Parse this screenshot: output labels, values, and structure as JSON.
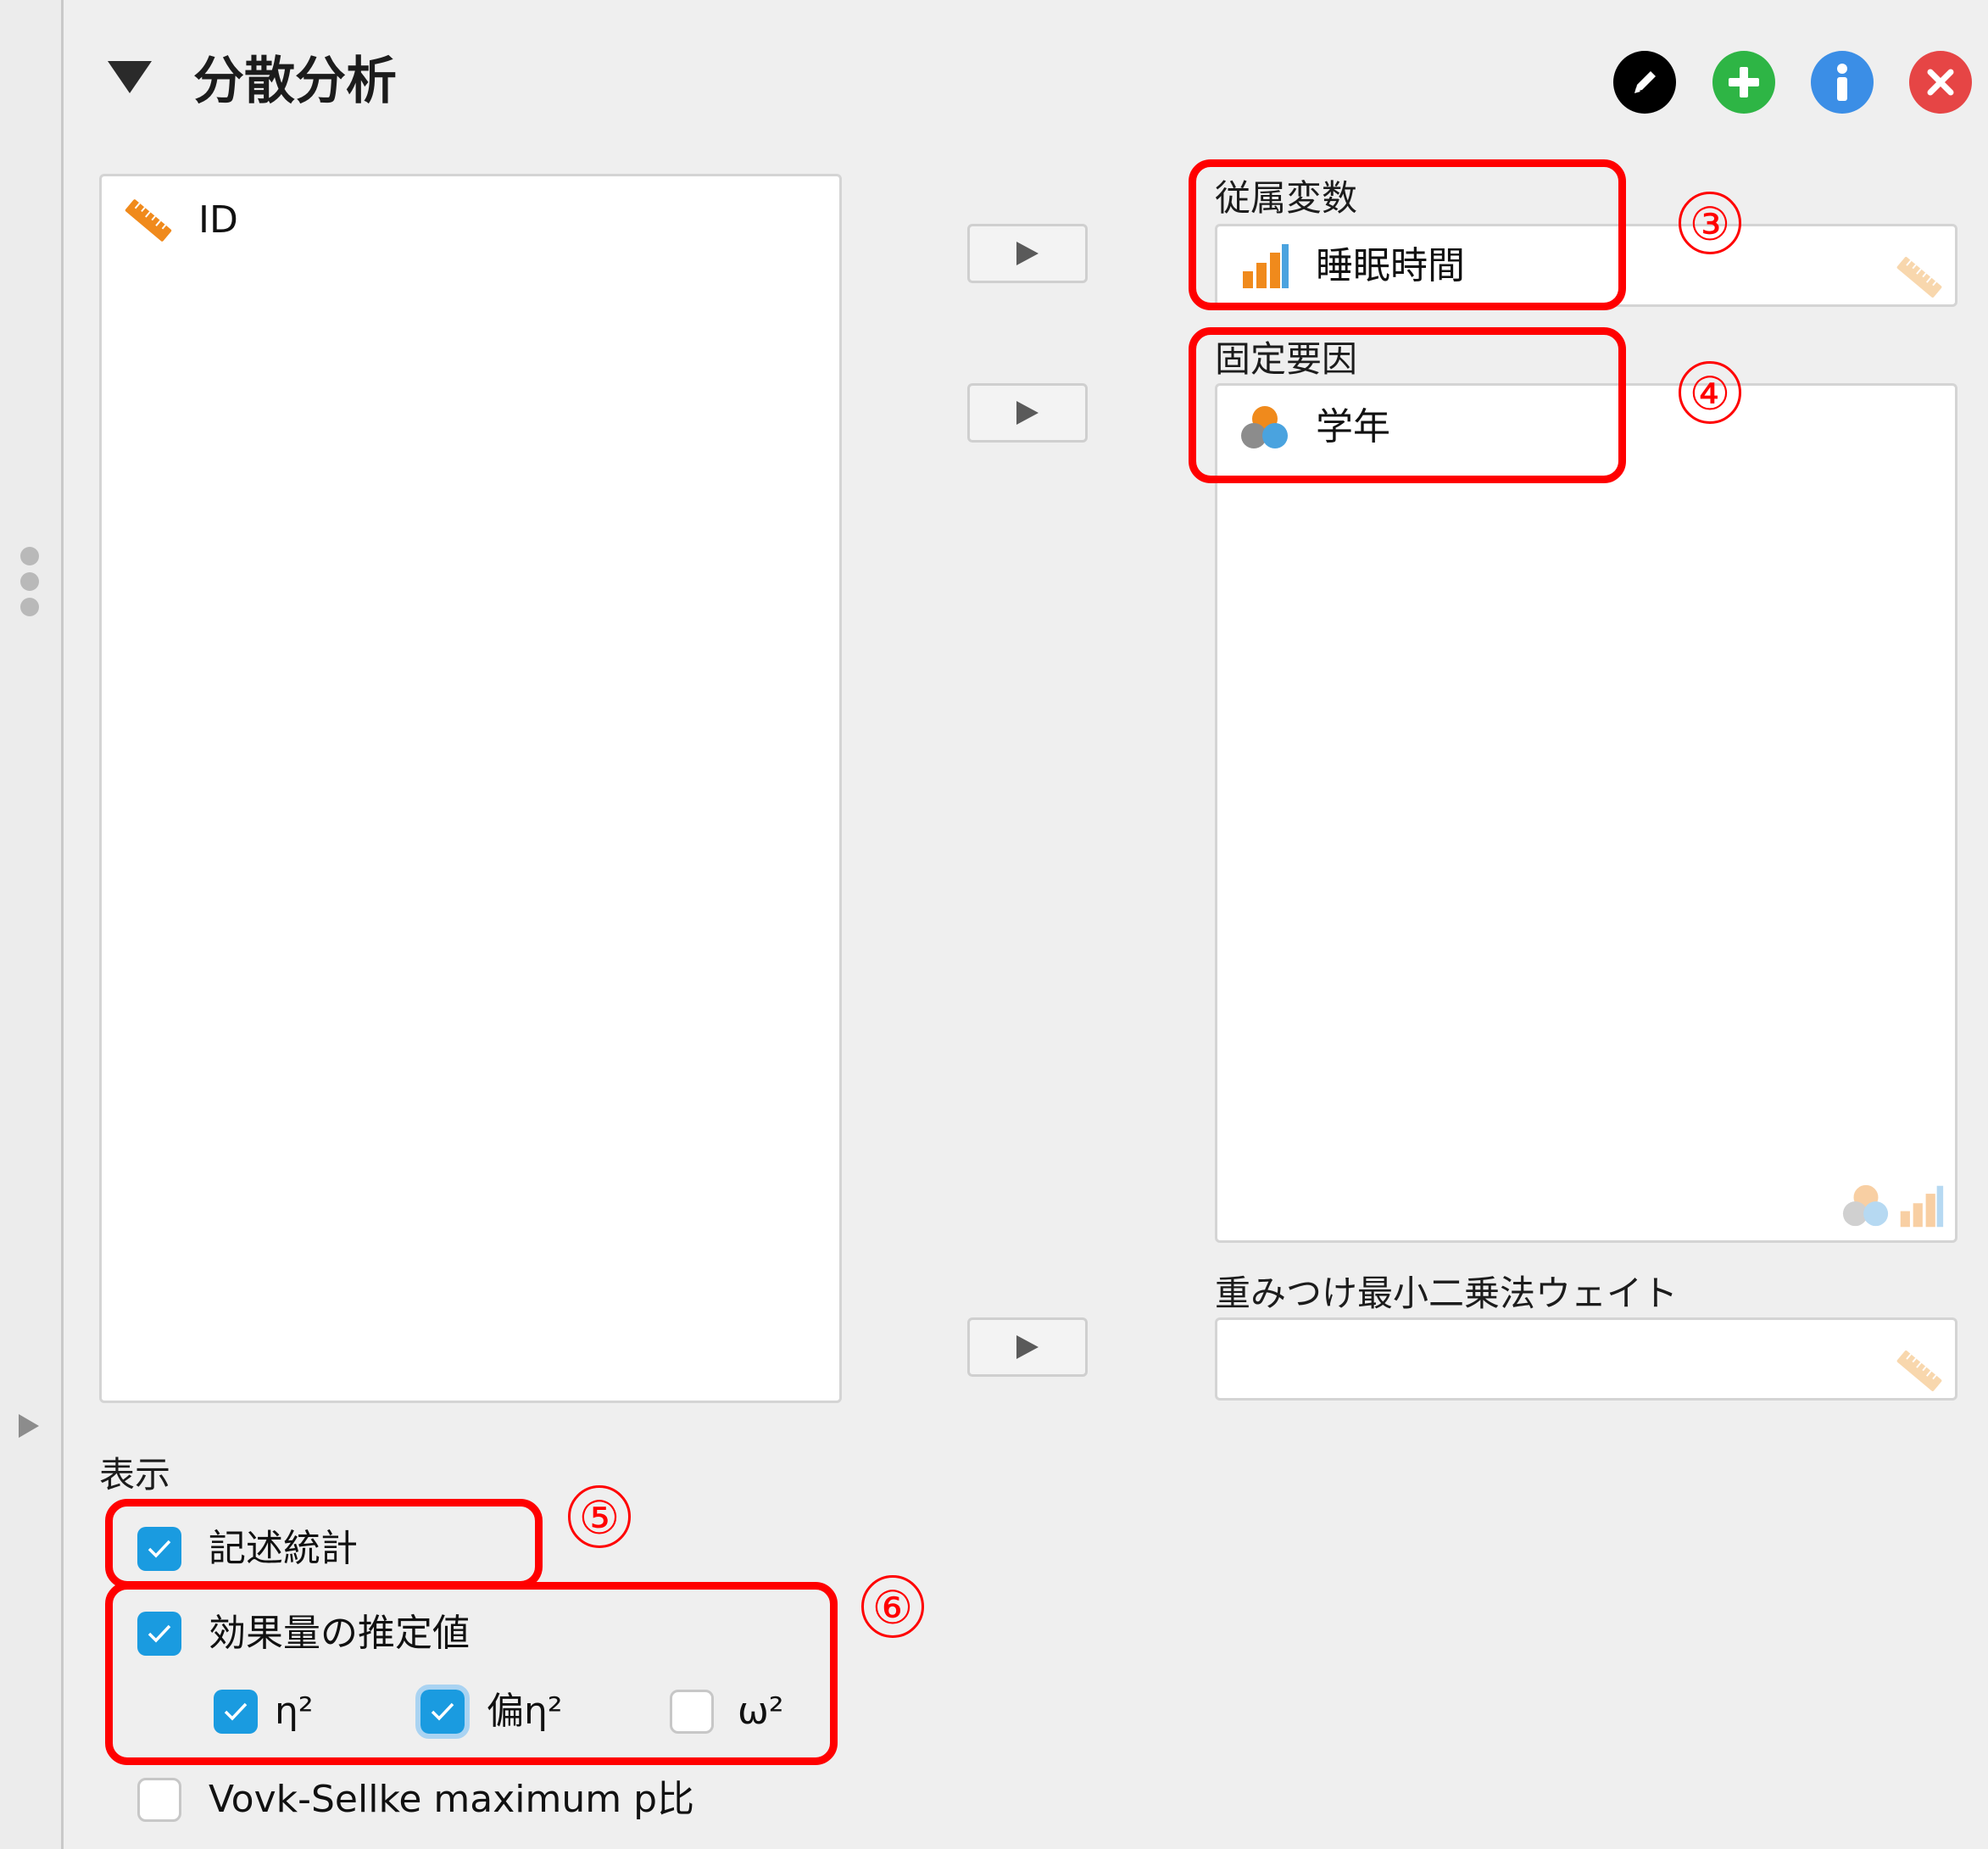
{
  "header": {
    "title": "分散分析"
  },
  "header_buttons": [
    "edit-icon",
    "add-icon",
    "info-icon",
    "close-icon"
  ],
  "variables_list": {
    "items": [
      {
        "label": "ID",
        "icon": "ruler-icon"
      }
    ]
  },
  "dependent": {
    "label": "従属変数",
    "value": "睡眠時間",
    "icon": "bar-chart-icon",
    "annotation": "③"
  },
  "fixed_factors": {
    "label": "固定要因",
    "items": [
      {
        "label": "学年",
        "icon": "nominal-circles-icon"
      }
    ],
    "annotation": "④"
  },
  "wls_weights": {
    "label": "重みつけ最小二乗法ウェイト",
    "value": ""
  },
  "display": {
    "label": "表示",
    "descriptives": {
      "label": "記述統計",
      "checked": true,
      "annotation": "⑤"
    },
    "effect_size": {
      "label": "効果量の推定値",
      "checked": true,
      "annotation": "⑥",
      "eta2": {
        "label": "η²",
        "checked": true
      },
      "partial_eta2": {
        "label": "偏η²",
        "checked": true
      },
      "omega2": {
        "label": "ω²",
        "checked": false
      }
    },
    "vovk": {
      "label": "Vovk-Sellke maximum p比",
      "checked": false
    }
  },
  "colors": {
    "annotation_red": "#ff0000",
    "checkbox_blue": "#1a9be0",
    "add_green": "#2eb545",
    "info_blue": "#3b8ee6",
    "close_red": "#e64545"
  }
}
